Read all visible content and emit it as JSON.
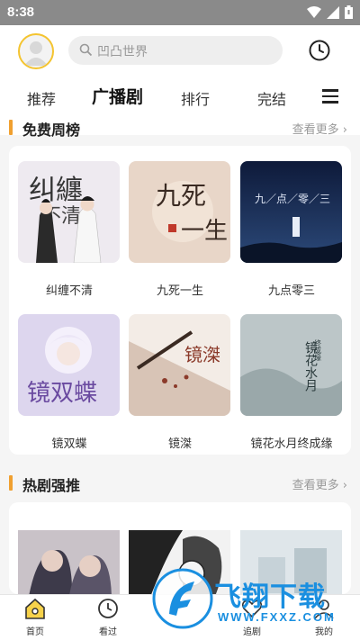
{
  "status_bar": {
    "time": "8:38"
  },
  "header": {
    "search_placeholder": "凹凸世界",
    "tabs": [
      {
        "label": "推荐"
      },
      {
        "label": "广播剧"
      },
      {
        "label": "排行"
      },
      {
        "label": "完结"
      }
    ],
    "active_tab": "广播剧"
  },
  "sections": [
    {
      "title": "免费周榜",
      "more": "查看更多",
      "items": [
        {
          "title": "纠缠不清"
        },
        {
          "title": "九死一生"
        },
        {
          "title": "九点零三"
        },
        {
          "title": "镜双蝶"
        },
        {
          "title": "镜滐"
        },
        {
          "title": "镜花水月终成缘"
        }
      ]
    },
    {
      "title": "热剧强推",
      "more": "查看更多"
    }
  ],
  "bottom_nav": [
    {
      "label": "首页",
      "icon": "home-icon"
    },
    {
      "label": "看过",
      "icon": "clock-icon"
    },
    {
      "label": "追剧",
      "icon": "heart-icon"
    },
    {
      "label": "我的",
      "icon": "user-icon"
    }
  ],
  "watermark": {
    "brand": "飞翔下载",
    "url": "WWW.FXXZ.COM"
  },
  "colors": {
    "accent": "#f0a030",
    "avatar_ring": "#f4c430",
    "watermark": "#1a8fe0"
  }
}
